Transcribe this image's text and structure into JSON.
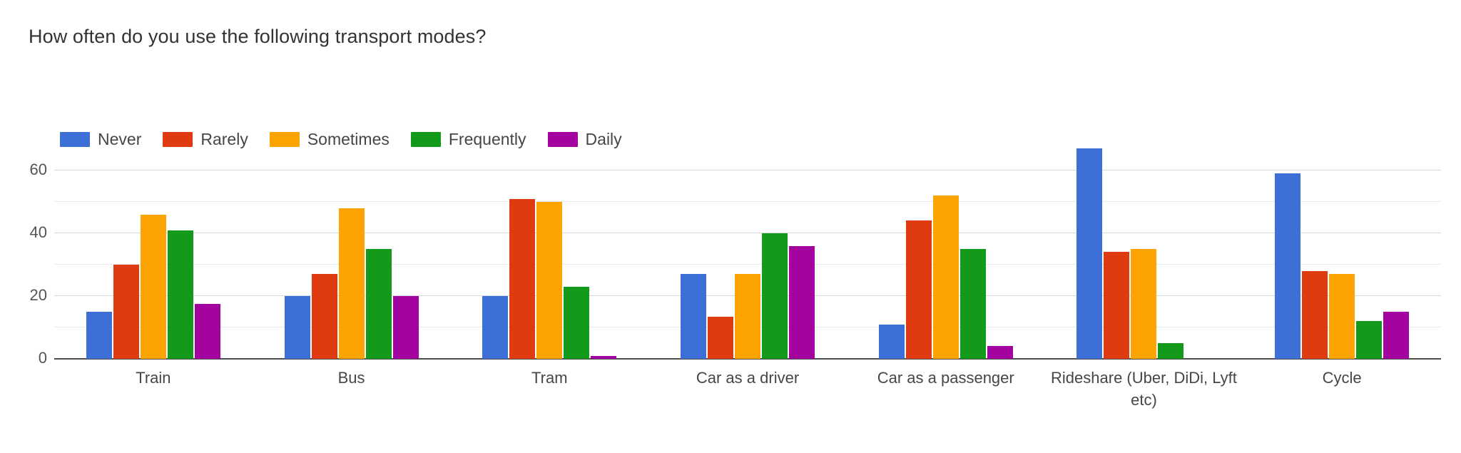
{
  "chart_data": {
    "type": "bar",
    "title": "How often do you use the following transport modes?",
    "xlabel": "",
    "ylabel": "",
    "ylim": [
      0,
      70
    ],
    "yticks": [
      "0",
      "20",
      "40",
      "60"
    ],
    "minor_gridlines": [
      10,
      30,
      50
    ],
    "grid": true,
    "legend_position": "top-left",
    "grouping": "grouped",
    "categories": [
      "Train",
      "Bus",
      "Tram",
      "Car as a driver",
      "Car as a passenger",
      "Rideshare (Uber, DiDi, Lyft etc)",
      "Cycle"
    ],
    "series": [
      {
        "name": "Never",
        "color": "#3d6fd6",
        "values": [
          15,
          20,
          20,
          27,
          11,
          67,
          59
        ]
      },
      {
        "name": "Rarely",
        "color": "#e03a10",
        "values": [
          30,
          27,
          51,
          13.5,
          44,
          34,
          28
        ]
      },
      {
        "name": "Sometimes",
        "color": "#fda302",
        "values": [
          46,
          48,
          50,
          27,
          52,
          35,
          27
        ]
      },
      {
        "name": "Frequently",
        "color": "#139a1b",
        "values": [
          41,
          35,
          23,
          40,
          35,
          5,
          12
        ]
      },
      {
        "name": "Daily",
        "color": "#a3039e",
        "values": [
          17.5,
          20,
          1,
          36,
          4,
          0,
          15
        ]
      }
    ]
  },
  "colors": {
    "background": "#ffffff",
    "title_text": "#333333",
    "axis_text": "#444746",
    "gridline": "#e8eaed",
    "gridline_major": "#d7dadd",
    "baseline": "#4b4b4b"
  }
}
